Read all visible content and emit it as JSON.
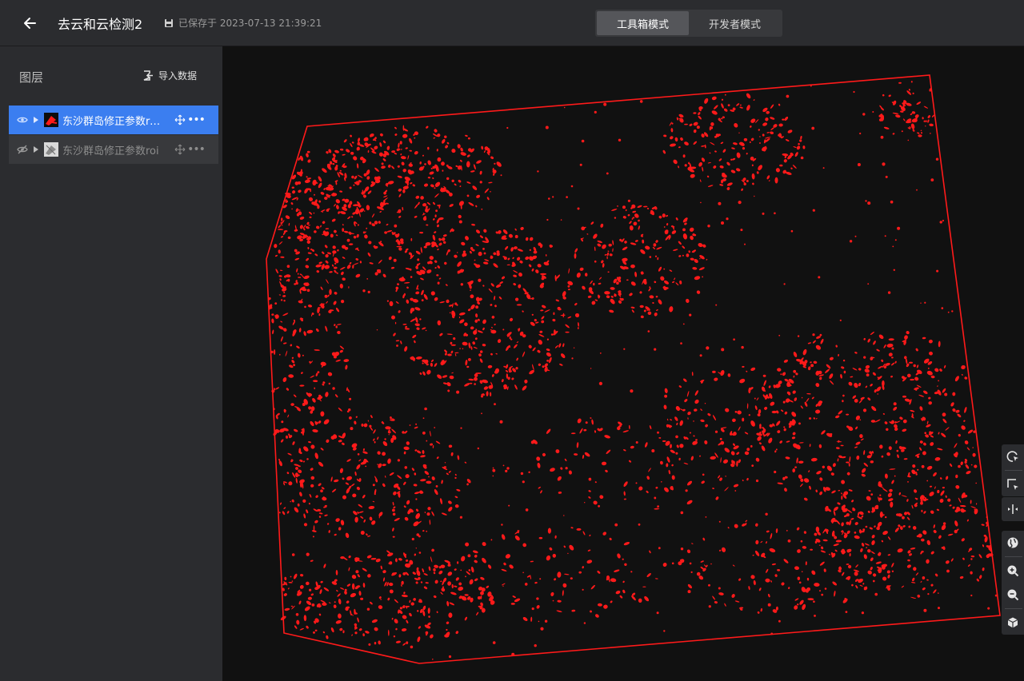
{
  "header": {
    "back_icon": "arrow-left-icon",
    "project_title": "去云和云检测2",
    "save_status": "已保存于 2023-07-13 21:39:21",
    "modes": [
      {
        "label": "工具箱模式",
        "active": true
      },
      {
        "label": "开发者模式",
        "active": false
      }
    ]
  },
  "sidebar": {
    "title": "图层",
    "import_label": "导入数据",
    "layers": [
      {
        "name": "东沙群岛修正参数roi...",
        "visible": true,
        "selected": true
      },
      {
        "name": "东沙群岛修正参数roi",
        "visible": false,
        "selected": false
      }
    ]
  },
  "toolbar": {
    "tools": [
      "select-query-icon",
      "box-select-icon",
      "split-compare-icon",
      "globe-icon",
      "zoom-in-icon",
      "zoom-out-icon",
      "3d-view-icon"
    ]
  },
  "colors": {
    "accent": "#3b7ef0",
    "raster_red": "#ff1a1a",
    "background": "#111111",
    "panel": "#2b2c2f"
  }
}
